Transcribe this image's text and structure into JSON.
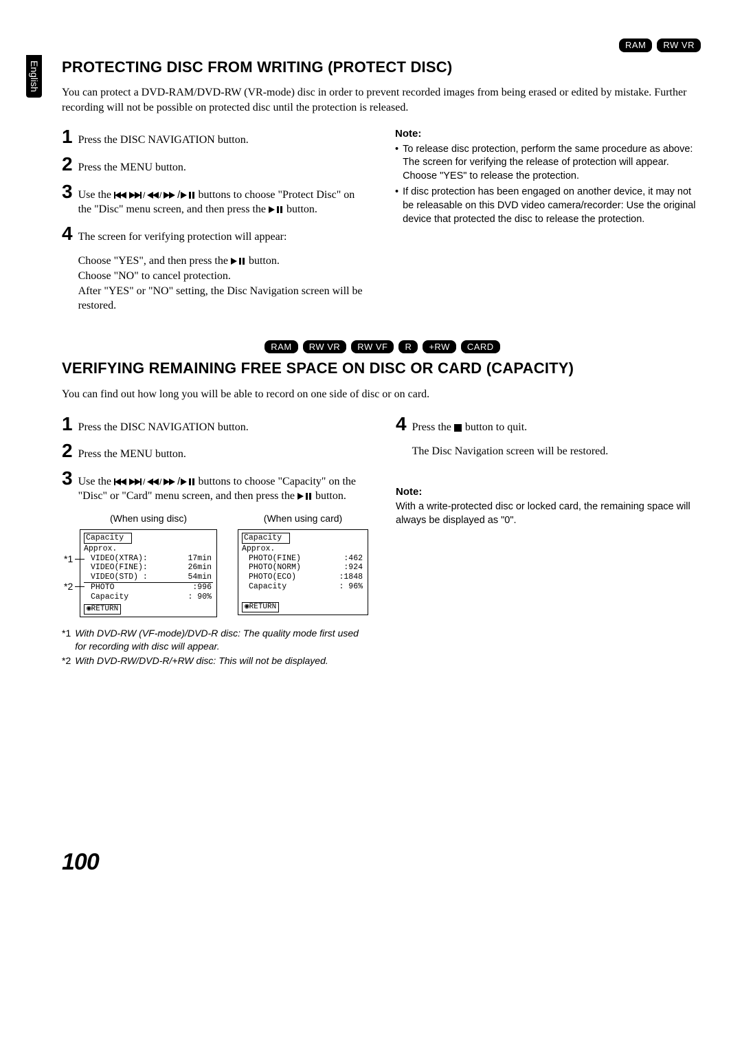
{
  "tab": "English",
  "section1": {
    "badges": [
      "RAM",
      "RW VR"
    ],
    "title": "PROTECTING DISC FROM WRITING (PROTECT DISC)",
    "intro": "You can protect a DVD-RAM/DVD-RW (VR-mode) disc in order to prevent recorded images from being erased or edited by mistake. Further recording will not be possible on protected disc until the protection is released.",
    "steps": {
      "1": "Press the DISC NAVIGATION button.",
      "2": "Press the MENU button.",
      "3_pre": "Use the ",
      "3_mid": " buttons to choose \"Protect Disc\" on the \"Disc\" menu screen, and then press the ",
      "3_post": " button.",
      "4": "The screen for verifying protection will appear:",
      "4_sub1_pre": "Choose \"YES\", and then press the ",
      "4_sub1_post": " button.",
      "4_sub2": "Choose \"NO\" to cancel protection.",
      "4_sub3": "After \"YES\" or \"NO\" setting, the Disc Navigation screen will be restored."
    },
    "note_label": "Note:",
    "notes": [
      "To release disc protection, perform the same procedure as above: The screen for verifying the release of protection will appear. Choose \"YES\" to release the protection.",
      "If disc protection has been engaged on another device, it may not be releasable on this DVD video camera/recorder: Use the original device that protected the disc to release the protection."
    ]
  },
  "section2": {
    "badges": [
      "RAM",
      "RW VR",
      "RW VF",
      "R",
      "+RW",
      "CARD"
    ],
    "title": "VERIFYING REMAINING FREE SPACE ON DISC OR CARD (CAPACITY)",
    "intro": "You can find out how long you will be able to record on one side of disc or on card.",
    "steps": {
      "1": "Press the DISC NAVIGATION button.",
      "2": "Press the MENU button.",
      "3_pre": "Use the ",
      "3_mid": " buttons to choose \"Capacity\" on the \"Disc\" or \"Card\" menu screen, and then press the ",
      "3_post": " button.",
      "4_pre": "Press the ",
      "4_post": " button to quit.",
      "4_sub": "The Disc Navigation screen will be restored."
    },
    "diag": {
      "disc_label": "(When using disc)",
      "card_label": "(When using card)",
      "star1": "*1",
      "star2": "*2",
      "osd_disc": {
        "title": "Capacity",
        "approx": "Approx.",
        "rows": [
          [
            "VIDEO(XTRA):",
            "17min"
          ],
          [
            "VIDEO(FINE):",
            "26min"
          ],
          [
            "VIDEO(STD) :",
            "54min"
          ],
          [
            "PHOTO",
            ":996"
          ],
          [
            "Capacity",
            ": 90%"
          ]
        ],
        "ret": "RETURN"
      },
      "osd_card": {
        "title": "Capacity",
        "approx": "Approx.",
        "rows": [
          [
            "PHOTO(FINE)",
            ":462"
          ],
          [
            "PHOTO(NORM)",
            ":924"
          ],
          [
            "PHOTO(ECO)",
            ":1848"
          ],
          [
            "Capacity",
            ": 96%"
          ]
        ],
        "ret": "RETURN"
      }
    },
    "footnotes": {
      "f1_label": "*1",
      "f1": "With DVD-RW (VF-mode)/DVD-R disc: The quality mode first used for recording with disc will appear.",
      "f2_label": "*2",
      "f2": "With DVD-RW/DVD-R/+RW disc: This will not be displayed."
    },
    "note_label": "Note:",
    "note": "With a write-protected disc or locked card, the remaining space will always be displayed as \"0\"."
  },
  "page_number": "100"
}
